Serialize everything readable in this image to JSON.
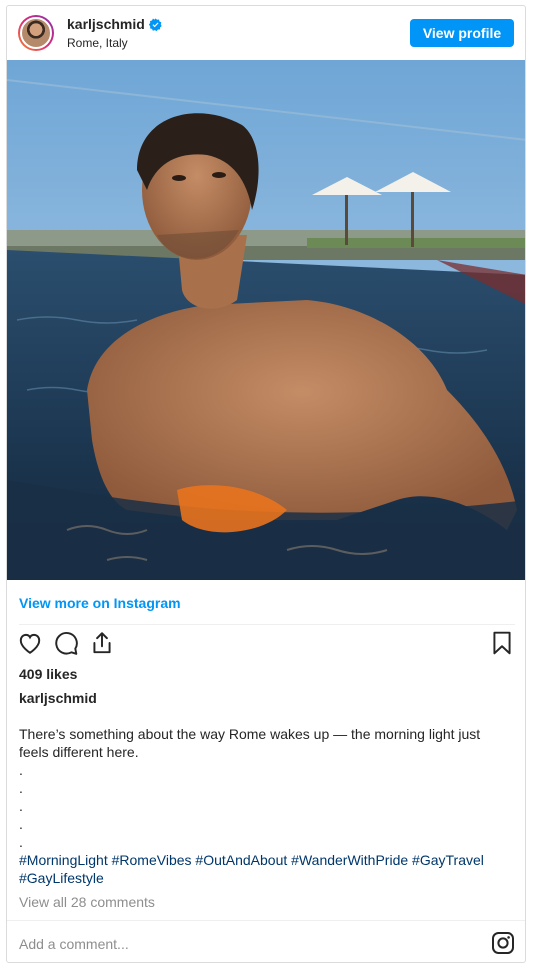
{
  "header": {
    "username": "karljschmid",
    "location": "Rome, Italy",
    "view_profile_label": "View profile"
  },
  "post": {
    "view_more_label": "View more on Instagram",
    "likes": "409 likes",
    "caption_user": "karljschmid",
    "caption_text": "There’s something about the way Rome wakes up — the morning light just feels different here.",
    "caption_dots": [
      ".",
      ".",
      ".",
      ".",
      "."
    ],
    "hashtags": [
      "#MorningLight",
      "#RomeVibes",
      "#OutAndAbout",
      "#WanderWithPride",
      "#GayTravel",
      "#GayLifestyle"
    ],
    "comments_link": "View all 28 comments",
    "add_comment_placeholder": "Add a comment..."
  },
  "icons": [
    "verified-badge-icon",
    "heart-icon",
    "comment-icon",
    "share-icon",
    "bookmark-icon",
    "instagram-logo-icon"
  ],
  "colors": {
    "accent": "#0095f6",
    "hashtag": "#00376b",
    "muted": "#8e8e8e",
    "text": "#262626"
  }
}
